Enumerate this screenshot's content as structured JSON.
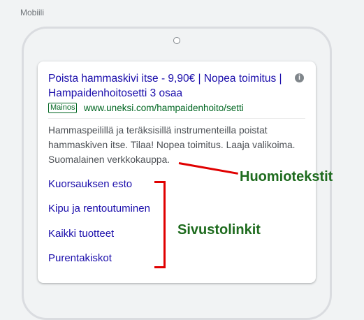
{
  "frame": {
    "label": "Mobiili"
  },
  "ad": {
    "headline_line1": "Poista hammaskivi itse - 9,90€ | Nopea toimitus |",
    "headline_line2": "Hampaidenhoitosetti 3 osaa",
    "info_icon": "i",
    "badge": "Mainos",
    "display_url": "www.uneksi.com/hampaidenhoito/setti",
    "description_line1": "Hammaspeilillä ja teräksisillä instrumenteilla poistat",
    "description_line2": "hammaskiven itse. Tilaa! Nopea toimitus. Laaja valikoima.",
    "description_line3": "Suomalainen verkkokauppa.",
    "sitelinks": [
      {
        "label": "Kuorsauksen esto"
      },
      {
        "label": "Kipu ja rentoutuminen"
      },
      {
        "label": "Kaikki tuotteet"
      },
      {
        "label": "Purentakiskot"
      }
    ]
  },
  "annotations": {
    "callout_label": "Huomiotekstit",
    "sitelinks_label": "Sivustolinkit",
    "marker_color": "#e00000",
    "label_color": "#1e6b1e"
  }
}
